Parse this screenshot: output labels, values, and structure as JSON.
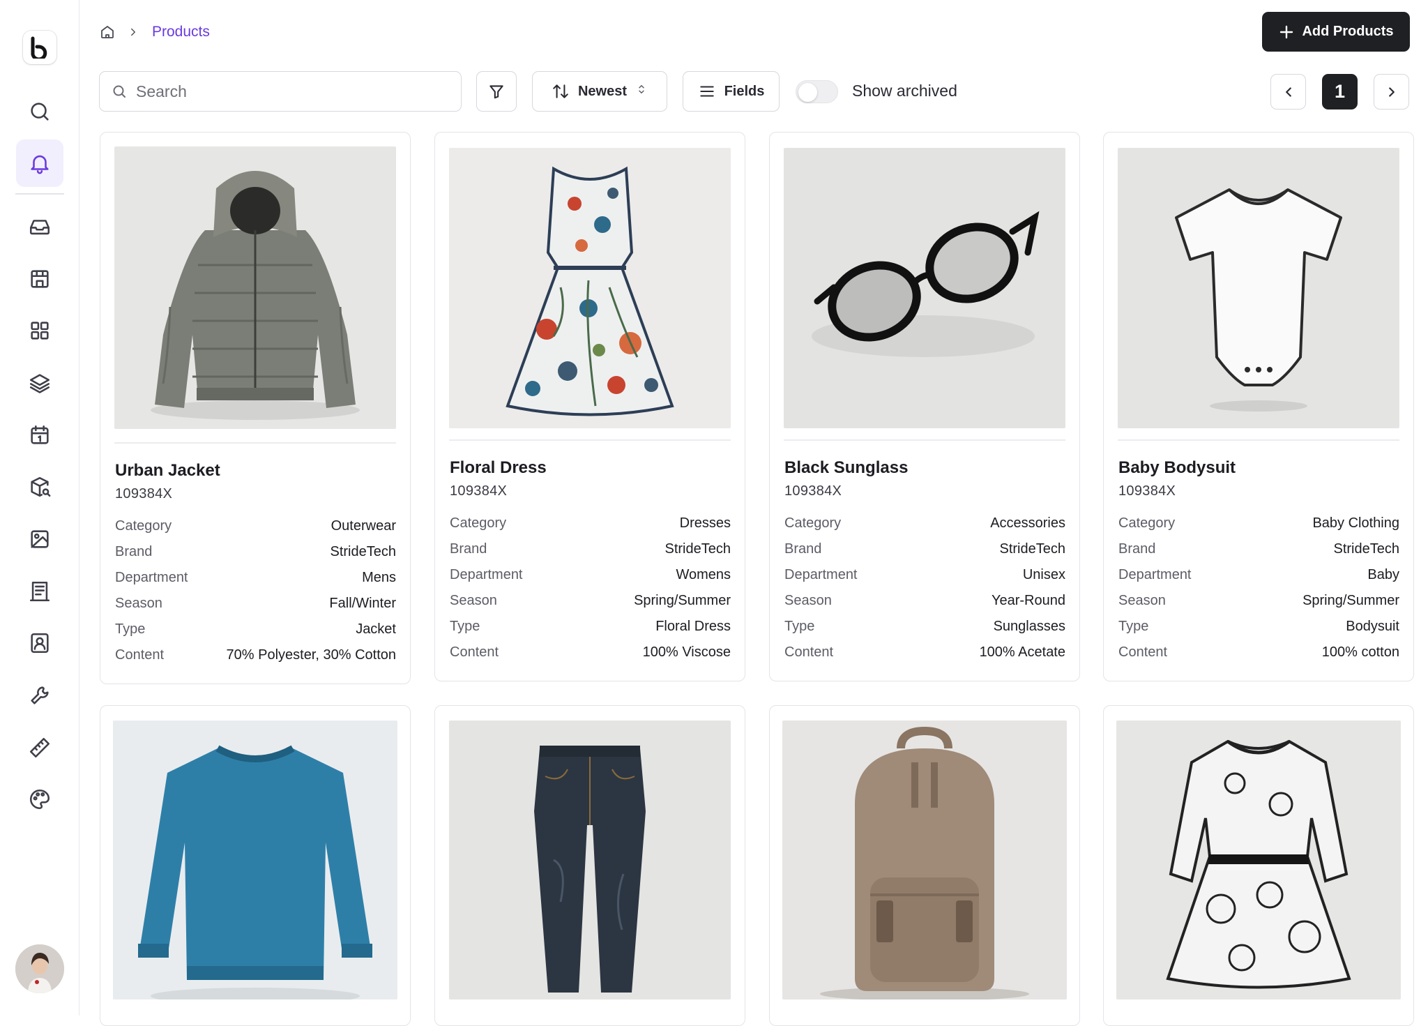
{
  "sidebar": {
    "logo": "b",
    "items": [
      {
        "icon": "search-icon"
      },
      {
        "icon": "bell-icon",
        "active": true
      },
      {
        "icon": "inbox-icon"
      },
      {
        "icon": "store-icon"
      },
      {
        "icon": "grid-icon"
      },
      {
        "icon": "layers-icon"
      },
      {
        "icon": "calendar-icon"
      },
      {
        "icon": "package-search-icon"
      },
      {
        "icon": "image-icon"
      },
      {
        "icon": "receipt-icon"
      },
      {
        "icon": "contact-icon"
      },
      {
        "icon": "wrench-icon"
      },
      {
        "icon": "ruler-icon"
      },
      {
        "icon": "palette-icon"
      }
    ]
  },
  "breadcrumb": {
    "current": "Products"
  },
  "header": {
    "add_label": "Add Products"
  },
  "toolbar": {
    "search_placeholder": "Search",
    "sort_label": "Newest",
    "fields_label": "Fields",
    "show_archived_label": "Show archived",
    "show_archived": false
  },
  "pagination": {
    "current_page": "1"
  },
  "colors": {
    "accent": "#6a3ae0",
    "dark": "#1f2023"
  },
  "spec_labels": {
    "category": "Category",
    "brand": "Brand",
    "department": "Department",
    "season": "Season",
    "type": "Type",
    "content": "Content"
  },
  "products": [
    {
      "name": "Urban Jacket",
      "sku": "109384X",
      "category": "Outerwear",
      "brand": "StrideTech",
      "department": "Mens",
      "season": "Fall/Winter",
      "type": "Jacket",
      "content": "70% Polyester, 30% Cotton",
      "image": "puffer-jacket"
    },
    {
      "name": "Floral Dress",
      "sku": "109384X",
      "category": "Dresses",
      "brand": "StrideTech",
      "department": "Womens",
      "season": "Spring/Summer",
      "type": "Floral Dress",
      "content": "100% Viscose",
      "image": "floral-dress"
    },
    {
      "name": "Black Sunglass",
      "sku": "109384X",
      "category": "Accessories",
      "brand": "StrideTech",
      "department": "Unisex",
      "season": "Year-Round",
      "type": "Sunglasses",
      "content": "100% Acetate",
      "image": "black-sunglasses"
    },
    {
      "name": "Baby Bodysuit",
      "sku": "109384X",
      "category": "Baby Clothing",
      "brand": "StrideTech",
      "department": "Baby",
      "season": "Spring/Summer",
      "type": "Bodysuit",
      "content": "100% cotton",
      "image": "baby-bodysuit"
    },
    {
      "image": "blue-sweater"
    },
    {
      "image": "dark-jeans"
    },
    {
      "image": "brown-backpack"
    },
    {
      "image": "floral-sketch-dress"
    }
  ]
}
